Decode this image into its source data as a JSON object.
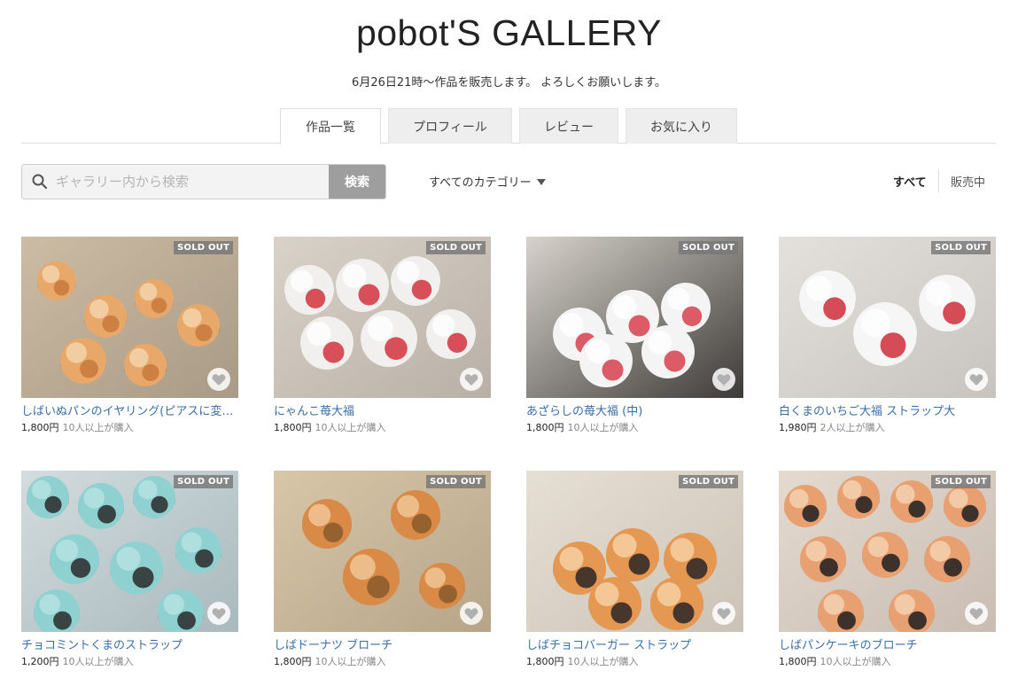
{
  "header": {
    "title": "pobot'S GALLERY",
    "subtitle": "6月26日21時〜作品を販売します。 よろしくお願いします。"
  },
  "tabs": [
    {
      "label": "作品一覧",
      "active": true
    },
    {
      "label": "プロフィール",
      "active": false
    },
    {
      "label": "レビュー",
      "active": false
    },
    {
      "label": "お気に入り",
      "active": false
    }
  ],
  "search": {
    "placeholder": "ギャラリー内から検索",
    "value": "",
    "button_label": "検索",
    "icon": "search-icon"
  },
  "category": {
    "selected": "すべてのカテゴリー",
    "icon": "caret-down-icon"
  },
  "filters": {
    "all": "すべて",
    "on_sale": "販売中",
    "selected": "all"
  },
  "products": [
    {
      "title": "しばいぬパンのイヤリング(ピアスに変更可)",
      "price": "1,800円",
      "buyers": "10人以上が購入",
      "badge": "SOLD OUT"
    },
    {
      "title": "にゃんこ苺大福",
      "price": "1,800円",
      "buyers": "10人以上が購入",
      "badge": "SOLD OUT"
    },
    {
      "title": "あざらしの苺大福 (中)",
      "price": "1,800円",
      "buyers": "10人以上が購入",
      "badge": "SOLD OUT"
    },
    {
      "title": "白くまのいちご大福 ストラップ大",
      "price": "1,980円",
      "buyers": "2人以上が購入",
      "badge": "SOLD OUT"
    },
    {
      "title": "チョコミントくまのストラップ",
      "price": "1,200円",
      "buyers": "10人以上が購入",
      "badge": "SOLD OUT"
    },
    {
      "title": "しばドーナツ ブローチ",
      "price": "1,800円",
      "buyers": "10人以上が購入",
      "badge": "SOLD OUT"
    },
    {
      "title": "しばチョコバーガー ストラップ",
      "price": "1,800円",
      "buyers": "10人以上が購入",
      "badge": "SOLD OUT"
    },
    {
      "title": "しばパンケーキのブローチ",
      "price": "1,800円",
      "buyers": "10人以上が購入",
      "badge": "SOLD OUT"
    }
  ],
  "colors": {
    "link": "#3a6ea5",
    "badge_bg": "#7a7a7a",
    "search_button": "#9e9e9e"
  }
}
